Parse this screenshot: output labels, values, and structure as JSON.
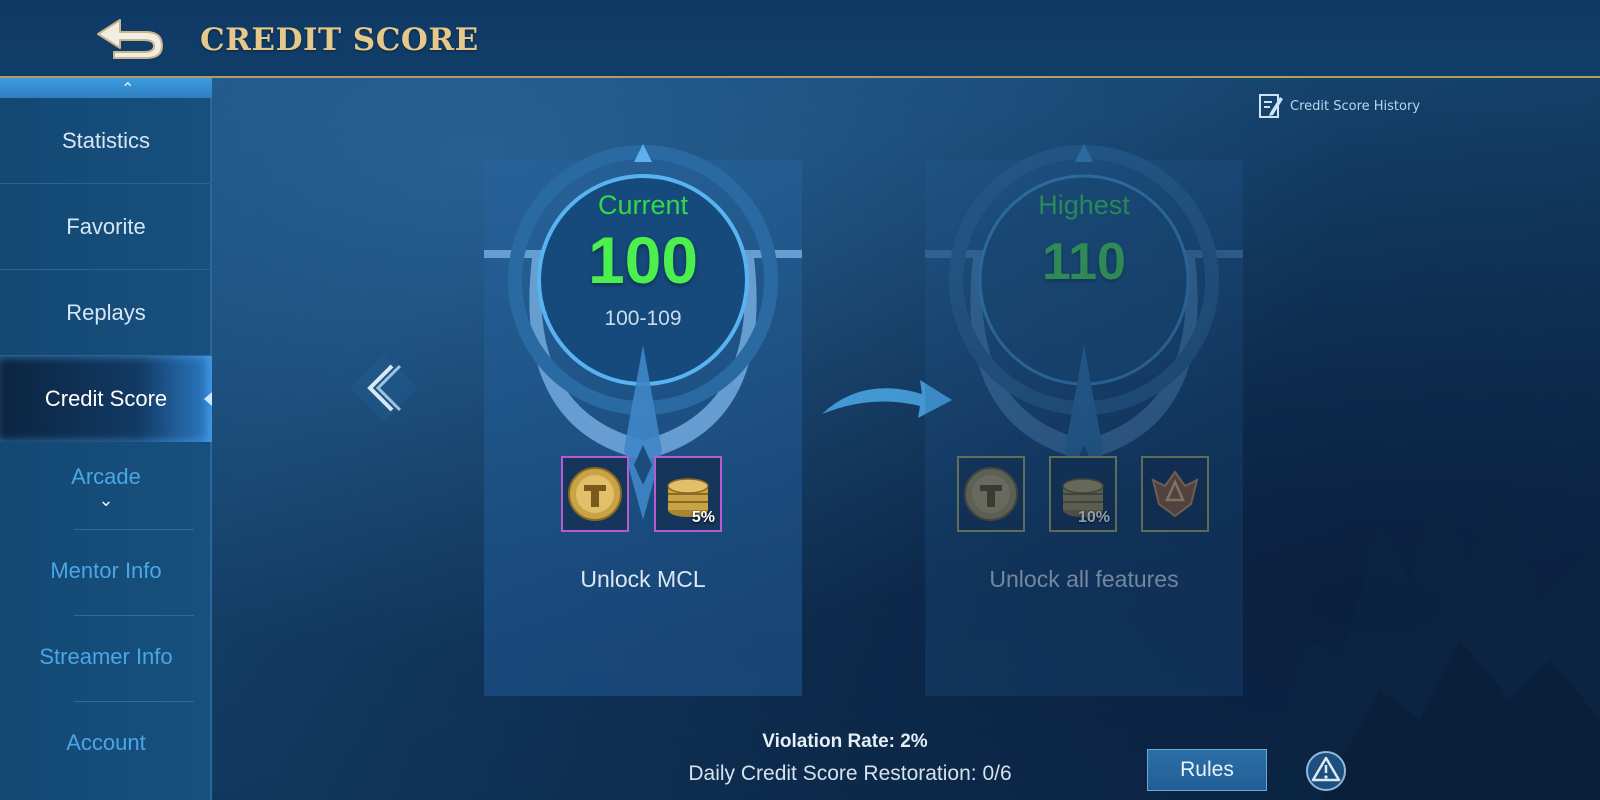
{
  "header": {
    "title": "CREDIT SCORE"
  },
  "sidebar": {
    "items": [
      {
        "label": "Statistics"
      },
      {
        "label": "Favorite"
      },
      {
        "label": "Replays"
      },
      {
        "label": "Credit Score",
        "active": true
      },
      {
        "label": "Arcade"
      },
      {
        "label": "Mentor Info"
      },
      {
        "label": "Streamer Info"
      },
      {
        "label": "Account"
      }
    ]
  },
  "history_link": {
    "label": "Credit Score History"
  },
  "current_card": {
    "label": "Current",
    "value": "100",
    "range": "100-109",
    "rewards": [
      {
        "icon": "t-coin-icon"
      },
      {
        "icon": "gold-coins-icon",
        "percent": "5%"
      }
    ],
    "caption": "Unlock MCL"
  },
  "highest_card": {
    "label": "Highest",
    "value": "110",
    "rewards": [
      {
        "icon": "t-coin-icon"
      },
      {
        "icon": "gold-coins-icon",
        "percent": "10%"
      },
      {
        "icon": "emblem-badge-icon"
      }
    ],
    "caption": "Unlock all features"
  },
  "footer": {
    "violation_rate": "Violation Rate: 2%",
    "restoration": "Daily Credit Score Restoration: 0/6",
    "rules_label": "Rules"
  },
  "colors": {
    "accent_gold": "#e6c88b",
    "score_green": "#4cf04e",
    "reward_border_purple": "#b65ccf"
  }
}
